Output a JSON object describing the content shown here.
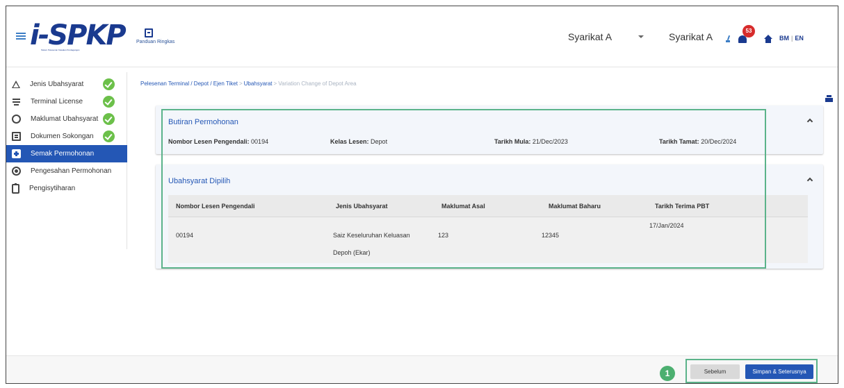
{
  "header": {
    "logo_text": "i-SPKP",
    "logo_subtitle": "Sistem Pelesenan Kawalan Perdagangan",
    "guide_label": "Panduan Ringkas",
    "company_select": "Syarikat A",
    "company_name": "Syarikat A",
    "notification_count": "53",
    "lang_bm": "BM",
    "lang_sep": "|",
    "lang_en": "EN"
  },
  "sidebar": {
    "items": [
      {
        "label": "Jenis Ubahsyarat",
        "icon": "triangle-icon",
        "done": true
      },
      {
        "label": "Terminal License",
        "icon": "filter-lines-icon",
        "done": true
      },
      {
        "label": "Maklumat Ubahsyarat",
        "icon": "circle-check-icon",
        "done": true
      },
      {
        "label": "Dokumen Sokongan",
        "icon": "document-icon",
        "done": true
      },
      {
        "label": "Semak Permohonan",
        "icon": "chat-plus-icon",
        "done": false,
        "active": true
      },
      {
        "label": "Pengesahan Permohonan",
        "icon": "disc-icon",
        "done": false
      },
      {
        "label": "Pengisytiharan",
        "icon": "clipboard-icon",
        "done": false
      }
    ]
  },
  "breadcrumb": {
    "items": [
      "Pelesenan Terminal / Depot / Ejen Tiket",
      "Ubahsyarat",
      "Variation Change of Depot Area"
    ],
    "separator": ">"
  },
  "panel1": {
    "title": "Butiran Permohonan",
    "fields": [
      {
        "label": "Nombor Lesen Pengendali:",
        "value": "00194"
      },
      {
        "label": "Kelas Lesen:",
        "value": "Depot"
      },
      {
        "label": "Tarikh Mula:",
        "value": "21/Dec/2023"
      },
      {
        "label": "Tarikh Tamat:",
        "value": "20/Dec/2024"
      }
    ]
  },
  "panel2": {
    "title": "Ubahsyarat Dipilih",
    "columns": [
      "Nombor Lesen Pengendali",
      "Jenis Ubahsyarat",
      "Maklumat Asal",
      "Maklumat Baharu",
      "Tarikh Terima PBT"
    ],
    "row": {
      "license": "00194",
      "type_line1": "Saiz Keseluruhan Keluasan",
      "type_line2": "Depoh (Ekar)",
      "original": "123",
      "new": "12345",
      "received": "17/Jan/2024"
    }
  },
  "footer": {
    "step_number": "1",
    "prev_label": "Sebelum",
    "next_label": "Simpan & Seterusnya"
  },
  "colors": {
    "primary": "#2457b5",
    "success": "#6cc04a",
    "highlight": "#5bb38a",
    "badge": "#d72c2c"
  }
}
